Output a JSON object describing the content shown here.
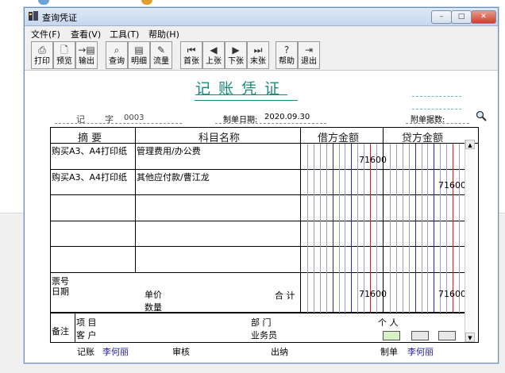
{
  "window": {
    "title": "查询凭证",
    "min": "–",
    "max": "□",
    "close": "✕"
  },
  "menu": [
    "文件(F)",
    "查看(V)",
    "工具(T)",
    "帮助(H)"
  ],
  "toolbar": {
    "print": "打印",
    "preview": "预览",
    "export": "输出",
    "query": "查询",
    "detail": "明细",
    "flow": "流量",
    "first": "首张",
    "prev": "上张",
    "next": "下张",
    "last": "末张",
    "help": "帮助",
    "exit": "退出"
  },
  "voucher": {
    "title": "记账凭证",
    "type_label": "记",
    "zi_label": "字",
    "number": "0003",
    "date_label": "制单日期:",
    "date": "2020.09.30",
    "attach_label": "附单据数:",
    "columns": {
      "summary": "摘 要",
      "subject": "科目名称",
      "debit": "借方金额",
      "credit": "贷方金额"
    },
    "rows": [
      {
        "summary": "购买A3、A4打印纸",
        "subject": "管理费用/办公费",
        "debit": "71600",
        "credit": ""
      },
      {
        "summary": "购买A3、A4打印纸",
        "subject": "其他应付款/曹江龙",
        "debit": "",
        "credit": "71600"
      }
    ],
    "footer": {
      "ticket_no": "票号",
      "date": "日期",
      "unit_price": "单价",
      "quantity": "数量",
      "total_label": "合 计",
      "total_debit": "71600",
      "total_credit": "71600",
      "remark": "备注",
      "project": "项 目",
      "dept": "部 门",
      "person": "个 人",
      "customer": "客 户",
      "salesman": "业务员"
    },
    "sign": {
      "bookkeeper_label": "记账",
      "bookkeeper": "李何丽",
      "review_label": "审核",
      "cashier_label": "出纳",
      "maker_label": "制单",
      "maker": "李何丽"
    }
  }
}
